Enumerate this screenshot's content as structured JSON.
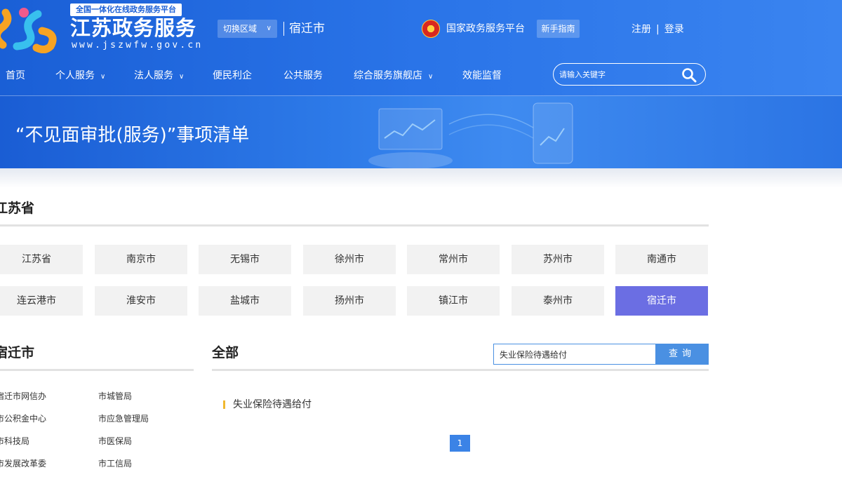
{
  "header": {
    "logo_tag": "全国一体化在线政务服务平台",
    "site_title": "江苏政务服务",
    "site_url": "www.jszwfw.gov.cn",
    "region_switch_label": "切换区域",
    "current_region": "宿迁市",
    "gov_platform_label": "国家政务服务平台",
    "guide_label": "新手指南",
    "register_label": "注册",
    "login_label": "登录",
    "separator": "|"
  },
  "nav": {
    "items": [
      {
        "label": "首页"
      },
      {
        "label": "个人服务"
      },
      {
        "label": "法人服务"
      },
      {
        "label": "便民利企"
      },
      {
        "label": "公共服务"
      },
      {
        "label": "综合服务旗舰店"
      },
      {
        "label": "效能监督"
      }
    ],
    "search_placeholder": "请输入关键字"
  },
  "banner": {
    "title": "“不见面审批(服务)”事项清单"
  },
  "province": {
    "title": "江苏省",
    "cities": [
      "江苏省",
      "南京市",
      "无锡市",
      "徐州市",
      "常州市",
      "苏州市",
      "南通市",
      "连云港市",
      "淮安市",
      "盐城市",
      "扬州市",
      "镇江市",
      "泰州市",
      "宿迁市"
    ],
    "active_city": "宿迁市"
  },
  "departments": {
    "title": "宿迁市",
    "items": [
      "宿迁市网信办",
      "市城管局",
      "市公积金中心",
      "市应急管理局",
      "市科技局",
      "市医保局",
      "市发展改革委",
      "市工信局"
    ]
  },
  "results": {
    "title": "全部",
    "search_value": "失业保险待遇给付",
    "query_label": "查询",
    "items": [
      "失业保险待遇给付"
    ],
    "current_page": "1"
  },
  "colors": {
    "header_blue": "#1a5fd6",
    "active_city": "#6b6ee3",
    "query_button": "#4a90e2",
    "result_marker": "#f0b830"
  }
}
